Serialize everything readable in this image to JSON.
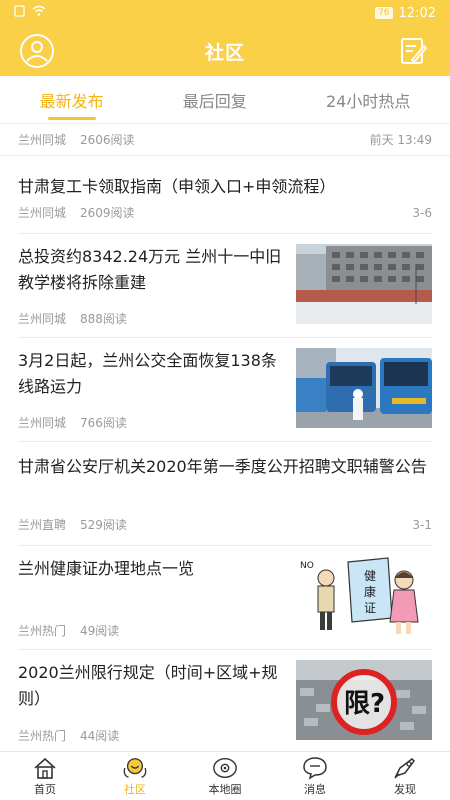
{
  "status": {
    "time": "12:02",
    "battery": "76"
  },
  "header": {
    "title": "社区"
  },
  "tabs": [
    {
      "label": "最新发布",
      "active": true
    },
    {
      "label": "最后回复",
      "active": false
    },
    {
      "label": "24小时热点",
      "active": false
    }
  ],
  "feed": {
    "partial": {
      "source": "兰州同城",
      "reads": "2606阅读",
      "time": "前天 13:49"
    },
    "items": [
      {
        "title": "甘肃复工卡领取指南（申领入口+申领流程）",
        "source": "兰州同城",
        "reads": "2609阅读",
        "time": "3-6",
        "thumb": null
      },
      {
        "title": "总投资约8342.24万元 兰州十一中旧教学楼将拆除重建",
        "source": "兰州同城",
        "reads": "888阅读",
        "time": "",
        "thumb": "building"
      },
      {
        "title": "3月2日起，兰州公交全面恢复138条线路运力",
        "source": "兰州同城",
        "reads": "766阅读",
        "time": "",
        "thumb": "bus"
      },
      {
        "title": "甘肃省公安厅机关2020年第一季度公开招聘文职辅警公告",
        "source": "兰州直聘",
        "reads": "529阅读",
        "time": "3-1",
        "thumb": null
      },
      {
        "title": "兰州健康证办理地点一览",
        "source": "兰州热门",
        "reads": "49阅读",
        "time": "",
        "thumb": "cartoon",
        "thumb_text": "NO",
        "sign_text": "健康证"
      },
      {
        "title": "2020兰州限行规定（时间+区域+规则）",
        "source": "兰州热门",
        "reads": "44阅读",
        "time": "",
        "thumb": "traffic",
        "thumb_text": "限?"
      }
    ]
  },
  "nav": [
    {
      "label": "首页",
      "icon": "home-icon",
      "active": false
    },
    {
      "label": "社区",
      "icon": "community-icon",
      "active": true
    },
    {
      "label": "本地圈",
      "icon": "local-circle-icon",
      "active": false
    },
    {
      "label": "消息",
      "icon": "message-icon",
      "active": false
    },
    {
      "label": "发现",
      "icon": "discover-icon",
      "active": false
    }
  ],
  "colors": {
    "brand": "#f9d047",
    "accent": "#f2b418"
  }
}
